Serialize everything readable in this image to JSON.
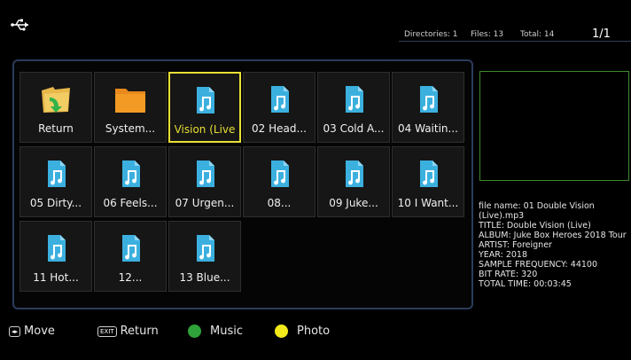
{
  "header": {
    "stats": {
      "directories": "Directories: 1",
      "files": "Files: 13",
      "total": "Total: 14"
    },
    "page_indicator": "1/1"
  },
  "browser": {
    "items": [
      {
        "label": "Return",
        "icon": "return-folder-icon",
        "selected": false
      },
      {
        "label": "System...",
        "icon": "folder-icon",
        "selected": false
      },
      {
        "label": "Vision (Live",
        "icon": "music-file-icon",
        "selected": true
      },
      {
        "label": "02 Head...",
        "icon": "music-file-icon",
        "selected": false
      },
      {
        "label": "03 Cold A...",
        "icon": "music-file-icon",
        "selected": false
      },
      {
        "label": "04 Waitin...",
        "icon": "music-file-icon",
        "selected": false
      },
      {
        "label": "05 Dirty...",
        "icon": "music-file-icon",
        "selected": false
      },
      {
        "label": "06 Feels...",
        "icon": "music-file-icon",
        "selected": false
      },
      {
        "label": "07 Urgen...",
        "icon": "music-file-icon",
        "selected": false
      },
      {
        "label": "08...",
        "icon": "music-file-icon",
        "selected": false
      },
      {
        "label": "09 Juke...",
        "icon": "music-file-icon",
        "selected": false
      },
      {
        "label": "10 I Want...",
        "icon": "music-file-icon",
        "selected": false
      },
      {
        "label": "11 Hot...",
        "icon": "music-file-icon",
        "selected": false
      },
      {
        "label": "12...",
        "icon": "music-file-icon",
        "selected": false
      },
      {
        "label": "13 Blue...",
        "icon": "music-file-icon",
        "selected": false
      }
    ]
  },
  "info": {
    "file_name": "file name: 01 Double Vision (Live).mp3",
    "title": "TITLE: Double Vision (Live)",
    "album": "ALBUM: Juke Box Heroes 2018 Tour",
    "artist": "ARTIST: Foreigner",
    "year": "YEAR: 2018",
    "sample_frequency": "SAMPLE FREQUENCY: 44100",
    "bit_rate": "BIT RATE: 320",
    "total_time": "TOTAL TIME: 00:03:45"
  },
  "bottom_bar": {
    "move_label": "Move",
    "move_key": "◂▸",
    "exit_key": "EXIT",
    "return_label": "Return",
    "music_label": "Music",
    "photo_label": "Photo"
  },
  "colors": {
    "music_dot": "#2fa23a",
    "photo_dot": "#f3ea1c",
    "selection": "#e8df35",
    "file_icon": "#3bb0df",
    "folder": "#f39a24"
  }
}
